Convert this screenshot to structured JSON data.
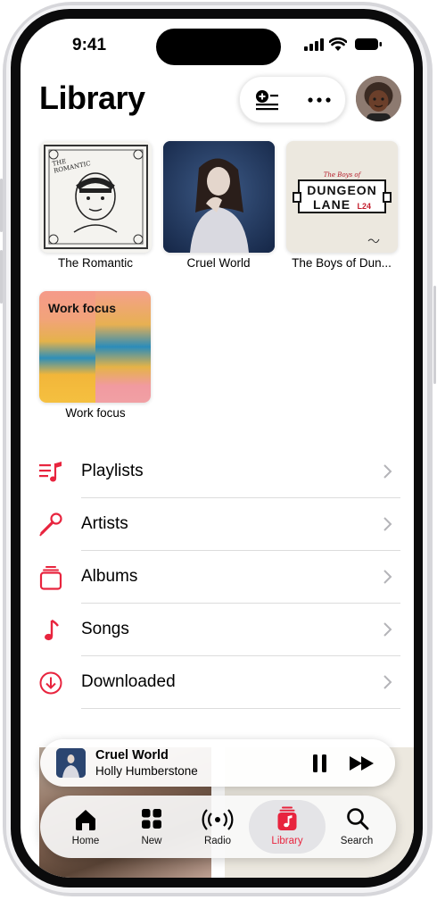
{
  "status": {
    "time": "9:41"
  },
  "header": {
    "title": "Library"
  },
  "albums": [
    {
      "title": "The Romantic",
      "art_text": "THE ROMANTIC"
    },
    {
      "title": "Cruel World"
    },
    {
      "title": "The Boys of Dun...",
      "art_line1": "DUNGEON",
      "art_line2": "LANE",
      "art_badge": "L24",
      "art_small": "The Boys of"
    }
  ],
  "playlist": {
    "title": "Work focus",
    "art_label": "Work focus"
  },
  "menu": [
    {
      "label": "Playlists",
      "icon": "playlist-icon"
    },
    {
      "label": "Artists",
      "icon": "microphone-icon"
    },
    {
      "label": "Albums",
      "icon": "album-stack-icon"
    },
    {
      "label": "Songs",
      "icon": "music-note-icon"
    },
    {
      "label": "Downloaded",
      "icon": "download-circle-icon"
    }
  ],
  "now_playing": {
    "title": "Cruel World",
    "artist": "Holly Humberstone"
  },
  "tabs": [
    {
      "label": "Home"
    },
    {
      "label": "New"
    },
    {
      "label": "Radio"
    },
    {
      "label": "Library"
    },
    {
      "label": "Search"
    }
  ],
  "colors": {
    "accent": "#e8243e",
    "text": "#000000",
    "separator": "#dcdcdc"
  }
}
